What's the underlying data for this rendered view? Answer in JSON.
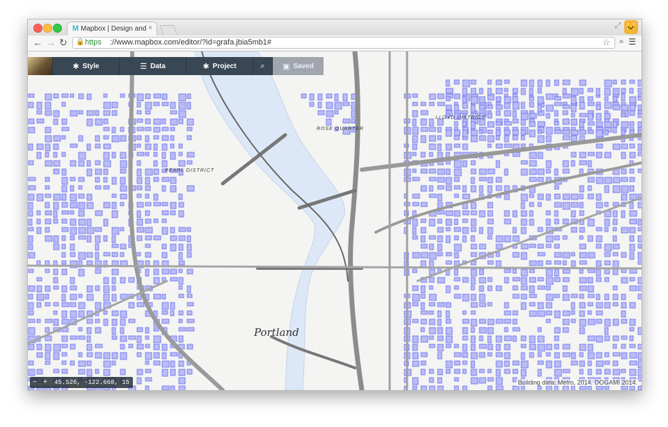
{
  "browser": {
    "tab_title": "Mapbox | Design and publ",
    "tab_favicon": "M",
    "tab_close": "×",
    "url_scheme": "https",
    "url_rest": "://www.mapbox.com/editor/?id=grafa.jbia5mb1#",
    "back_icon": "arrow-left",
    "forward_icon": "arrow-right",
    "reload_icon": "reload",
    "bookmark_icon": "star",
    "extensions_label": "»",
    "menu_icon": "hamburger"
  },
  "editor": {
    "menu": {
      "style_label": "Style",
      "data_label": "Data",
      "project_label": "Project",
      "saved_label": "Saved"
    },
    "coords": "45.526, -122.668, 15",
    "zoom_out": "−",
    "zoom_in": "+",
    "attribution": "Building data: Metro, 2014. DOGAMI 2014."
  },
  "map": {
    "city_label": "Portland",
    "district_labels": [
      "PEARL DISTRICT",
      "ROSE QUARTER",
      "LLOYD DISTRICT"
    ],
    "colors": {
      "water": "#dce8f7",
      "building_fill": "#b9bcf5",
      "building_stroke": "#5a5ef0",
      "road": "#8a8a8a",
      "land": "#f4f4f2"
    }
  }
}
